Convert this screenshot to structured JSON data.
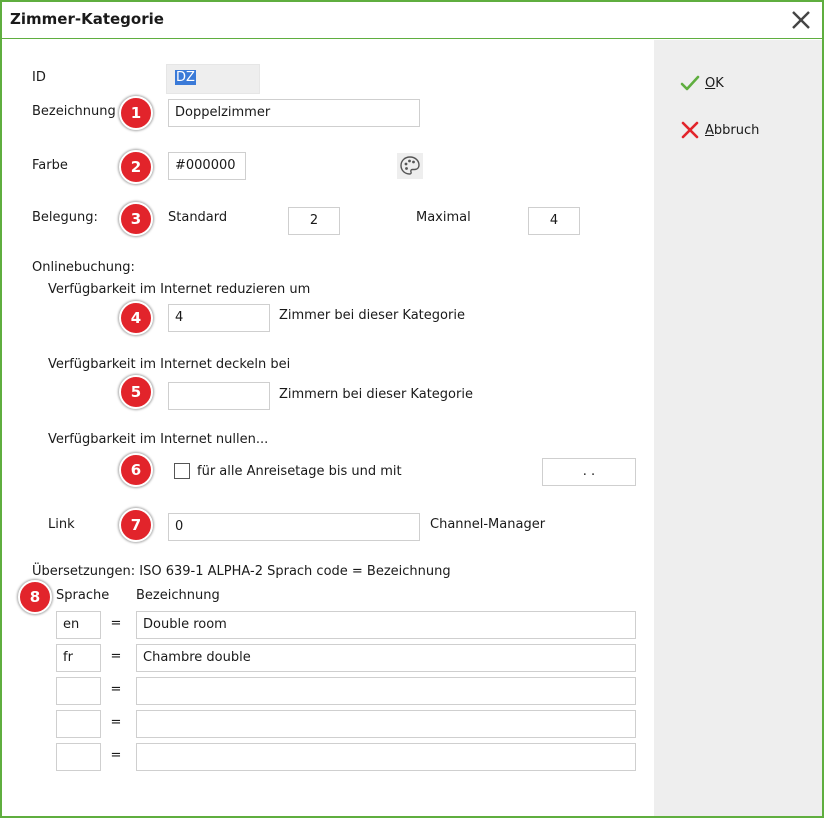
{
  "window": {
    "title": "Zimmer-Kategorie"
  },
  "buttons": {
    "ok": "OK",
    "cancel": "Abbruch"
  },
  "fields": {
    "id": {
      "label": "ID",
      "value": "DZ"
    },
    "bezeichnung": {
      "label": "Bezeichnung",
      "value": "Doppelzimmer"
    },
    "farbe": {
      "label": "Farbe",
      "value": "#000000"
    },
    "belegung": {
      "label": "Belegung:",
      "standard_label": "Standard",
      "standard_value": "2",
      "maximal_label": "Maximal",
      "maximal_value": "4"
    }
  },
  "online": {
    "section_label": "Onlinebuchung:",
    "reduce": {
      "label": "Verfügbarkeit im Internet reduzieren um",
      "value": "4",
      "suffix": "Zimmer bei dieser Kategorie"
    },
    "cap": {
      "label": "Verfügbarkeit im Internet deckeln bei",
      "value": "",
      "suffix": "Zimmern bei dieser Kategorie"
    },
    "zero": {
      "label": "Verfügbarkeit im Internet nullen...",
      "checkbox_label": "für alle Anreisetage bis und mit",
      "checked": false,
      "date_value": ". ."
    },
    "link": {
      "label": "Link",
      "value": "0",
      "suffix": "Channel-Manager"
    }
  },
  "translations": {
    "section_label": "Übersetzungen: ISO 639-1 ALPHA-2 Sprach code = Bezeichnung",
    "col_lang": "Sprache",
    "col_name": "Bezeichnung",
    "rows": [
      {
        "lang": "en",
        "eq": "=",
        "name": "Double room"
      },
      {
        "lang": "fr",
        "eq": "=",
        "name": "Chambre double"
      },
      {
        "lang": "",
        "eq": "=",
        "name": ""
      },
      {
        "lang": "",
        "eq": "=",
        "name": ""
      },
      {
        "lang": "",
        "eq": "=",
        "name": ""
      }
    ]
  },
  "badges": [
    "1",
    "2",
    "3",
    "4",
    "5",
    "6",
    "7",
    "8"
  ],
  "icons": {
    "ok": "checkmark-icon",
    "cancel": "x-icon",
    "close": "close-icon",
    "palette": "palette-icon"
  },
  "colors": {
    "border": "#5fae3f",
    "badge": "#e2242b",
    "ok": "#5fae3f",
    "cancel": "#e2242b",
    "side_panel": "#eeeeee"
  }
}
